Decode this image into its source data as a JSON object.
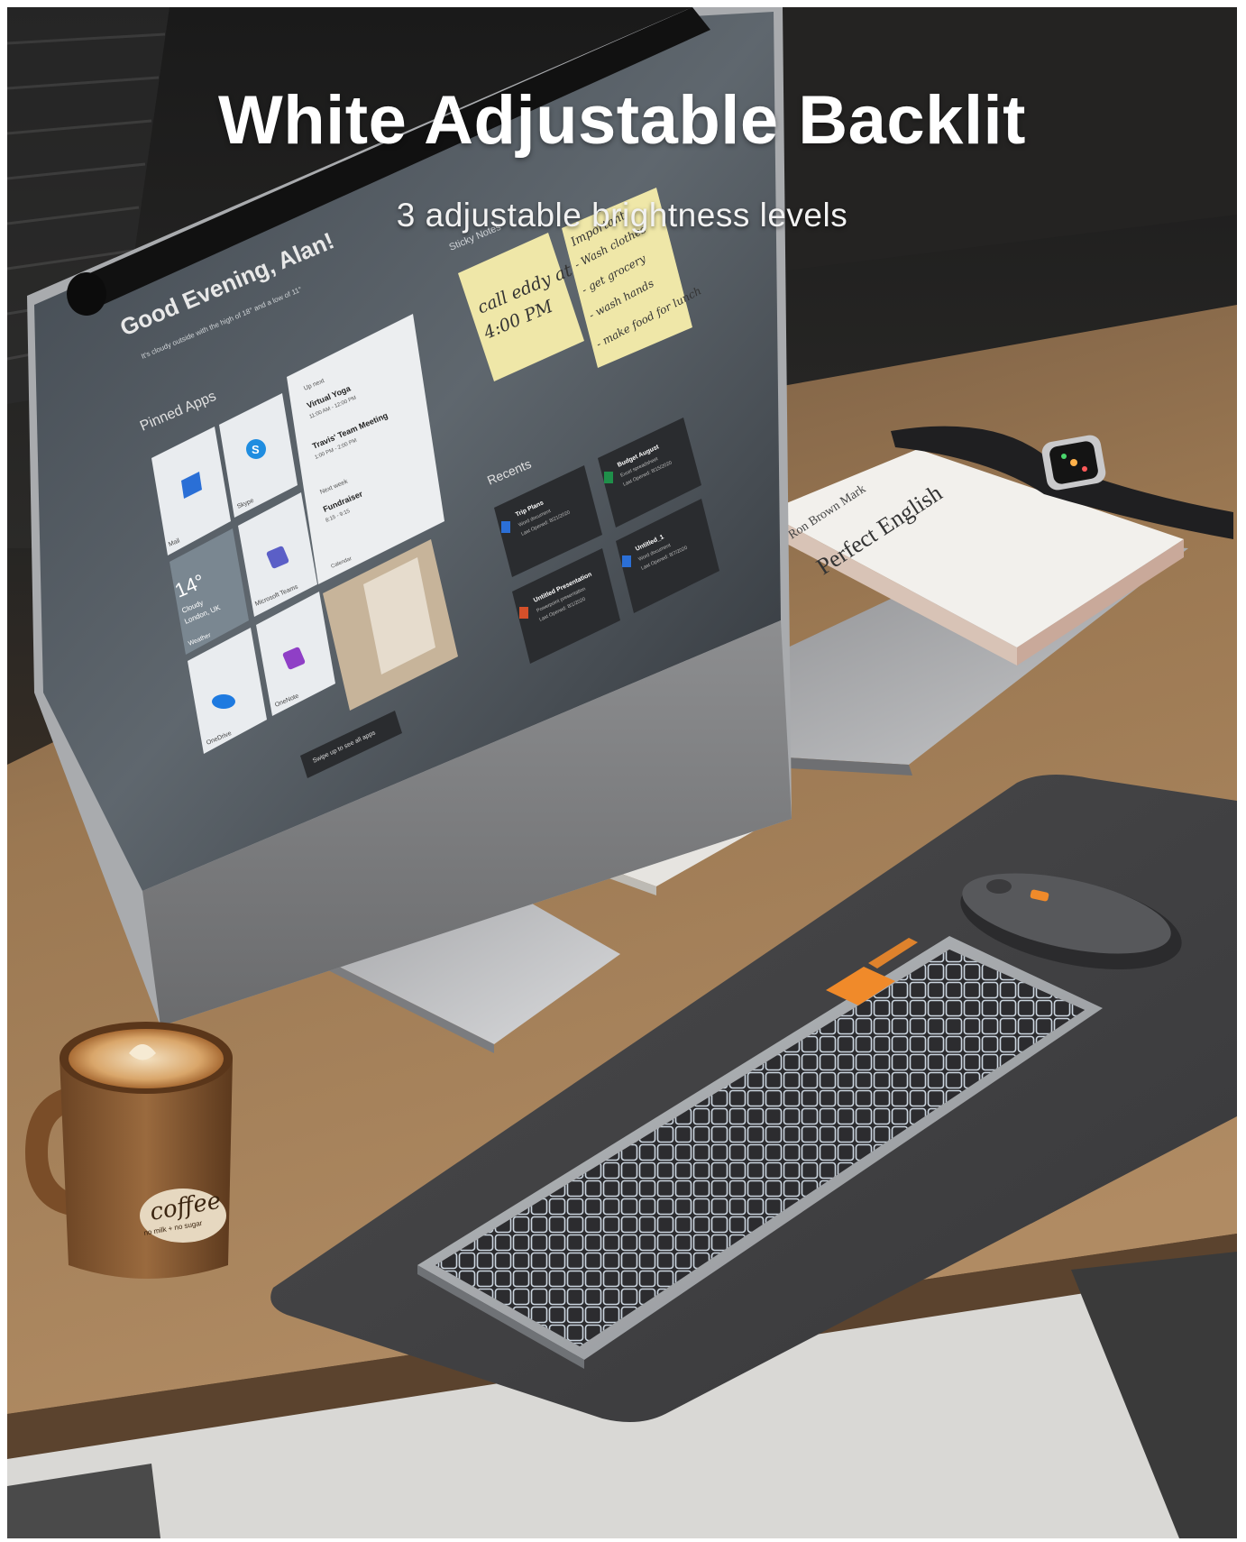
{
  "headline": "White Adjustable Backlit",
  "subheadline": "3 adjustable brightness levels",
  "screen": {
    "greeting": "Good Evening, Alan!",
    "weather_note": "It's cloudy outside with the high of 18° and a low of 11°",
    "pinned_apps_label": "Pinned Apps",
    "apps": [
      "Mail",
      "Skype",
      "Weather",
      "Microsoft Teams",
      "OneDrive",
      "OneNote"
    ],
    "weather_temp": "14°",
    "weather_desc": "Cloudy",
    "weather_city": "London, UK",
    "calendar": {
      "up_next_label": "Up next",
      "events": [
        "Virtual Yoga",
        "Travis' Team Meeting"
      ],
      "event_times": [
        "11:00 AM - 12:00 PM",
        "1:00 PM - 2:00 PM"
      ],
      "next_week_label": "Next week",
      "next_week_event": "Fundraiser",
      "next_week_time": "8:15 - 9:15",
      "app_label": "Calendar"
    },
    "sticky_label": "Sticky Notes",
    "sticky_note_1": [
      "call eddy at",
      "4:00 PM"
    ],
    "sticky_note_2_title": "Important",
    "sticky_note_2_items": [
      "- Wash clothes",
      "- get grocery",
      "- wash hands",
      "- make food for lunch"
    ],
    "recents_label": "Recents",
    "recents": [
      {
        "name": "Trip Plans",
        "type": "Word document",
        "opened": "Last Opened: 8/21/2020"
      },
      {
        "name": "Budget August",
        "type": "Excel spreadsheet",
        "opened": "Last Opened: 8/15/2020"
      },
      {
        "name": "Untitled Presentation",
        "type": "Powerpoint presentation",
        "opened": "Last Opened: 8/1/2020"
      },
      {
        "name": "Untitled_1",
        "type": "Word document",
        "opened": "Last Opened: 8/7/2020"
      }
    ],
    "swipe_hint": "Swipe up to see all apps"
  },
  "book": {
    "author": "Ron Brown Mark",
    "title": "Perfect English"
  },
  "mug": {
    "brand": "coffee",
    "tagline": "no milk + no sugar"
  },
  "colors": {
    "accent_orange": "#f08a2a",
    "key_dark": "#2e2e30",
    "backlight": "#dfe9f2",
    "mat": "#404042",
    "desk": "#a07c57"
  }
}
